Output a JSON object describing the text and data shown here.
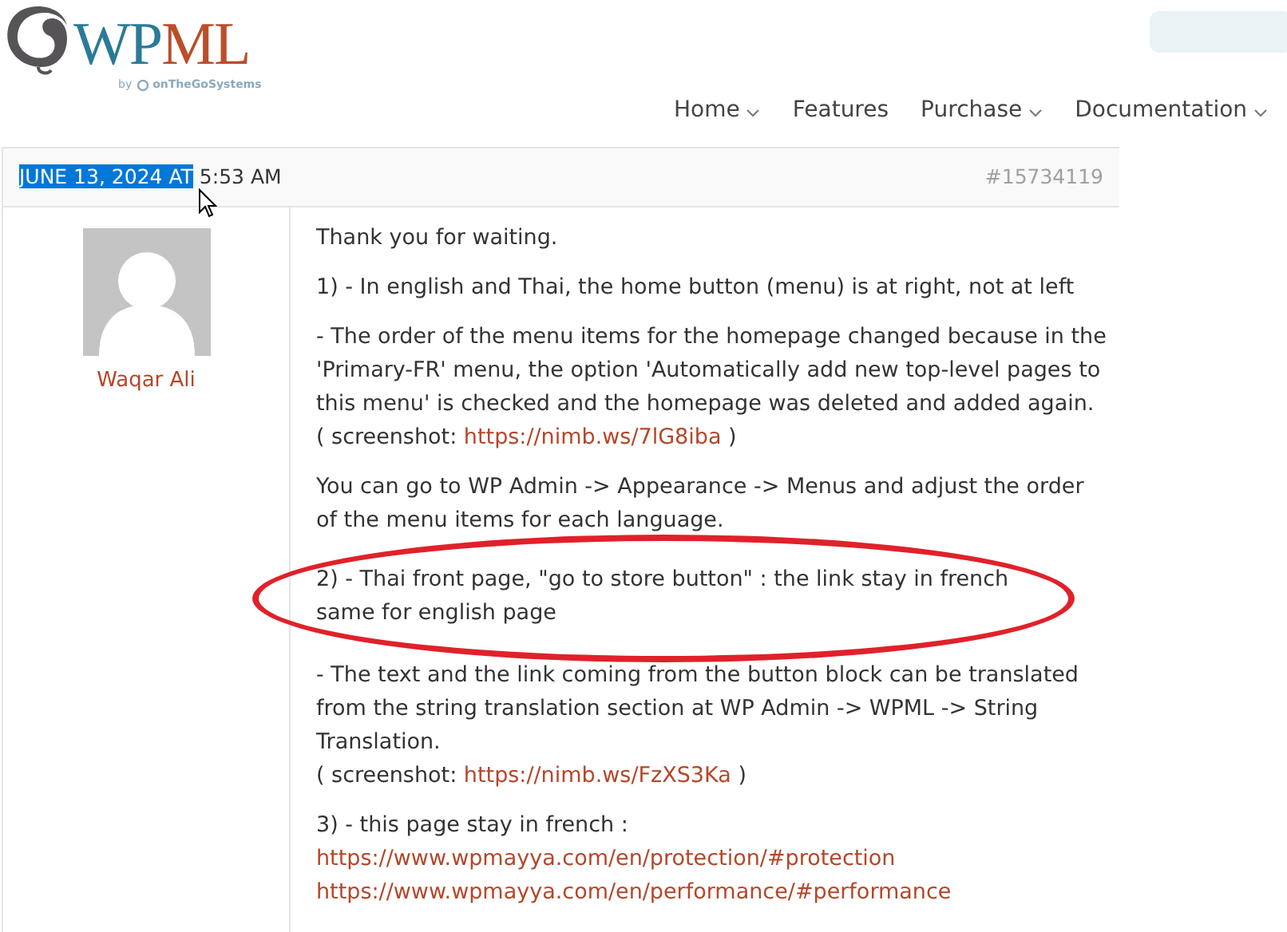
{
  "header": {
    "logo": {
      "primary": "WP",
      "accent": "ML",
      "byline": "by",
      "company": "onTheGoSystems"
    },
    "nav": [
      {
        "label": "Home",
        "dropdown": true
      },
      {
        "label": "Features",
        "dropdown": false
      },
      {
        "label": "Purchase",
        "dropdown": true
      },
      {
        "label": "Documentation",
        "dropdown": true
      }
    ]
  },
  "post": {
    "date_selected": "JUNE 13, 2024 AT",
    "date_rest": "5:53 AM",
    "number": "#15734119",
    "author": "Waqar Ali",
    "paragraphs": [
      {
        "circled": false,
        "lines": [
          [
            {
              "kind": "text",
              "text": "Thank you for waiting."
            }
          ]
        ]
      },
      {
        "circled": false,
        "lines": [
          [
            {
              "kind": "text",
              "text": "1) - In english and Thai, the home button (menu) is at right, not at left"
            }
          ]
        ]
      },
      {
        "circled": false,
        "lines": [
          [
            {
              "kind": "text",
              "text": "- The order of the menu items for the homepage changed because in the 'Primary-FR' menu, the option 'Automatically add new top-level pages to this menu' is checked and the homepage was deleted and added again."
            }
          ],
          [
            {
              "kind": "text",
              "text": "( screenshot: "
            },
            {
              "kind": "link",
              "text": "https://nimb.ws/7lG8iba"
            },
            {
              "kind": "text",
              "text": " )"
            }
          ]
        ]
      },
      {
        "circled": false,
        "lines": [
          [
            {
              "kind": "text",
              "text": "You can go to WP Admin -> Appearance -> Menus and adjust the order of the menu items for each language."
            }
          ]
        ]
      },
      {
        "circled": true,
        "lines": [
          [
            {
              "kind": "text",
              "text": "2) - Thai front page, \"go to store button\" : the link stay in french same for english page"
            }
          ]
        ]
      },
      {
        "circled": false,
        "lines": [
          [
            {
              "kind": "text",
              "text": "- The text and the link coming from the button block can be translated from the string translation section at WP Admin -> WPML -> String Translation."
            }
          ],
          [
            {
              "kind": "text",
              "text": "( screenshot: "
            },
            {
              "kind": "link",
              "text": "https://nimb.ws/FzXS3Ka"
            },
            {
              "kind": "text",
              "text": " )"
            }
          ]
        ]
      },
      {
        "circled": false,
        "lines": [
          [
            {
              "kind": "text",
              "text": "3) - this page stay in french :"
            }
          ],
          [
            {
              "kind": "link",
              "text": "https://www.wpmayya.com/en/protection/#protection"
            }
          ],
          [
            {
              "kind": "link",
              "text": "https://www.wpmayya.com/en/performance/#performance"
            }
          ]
        ]
      }
    ]
  }
}
